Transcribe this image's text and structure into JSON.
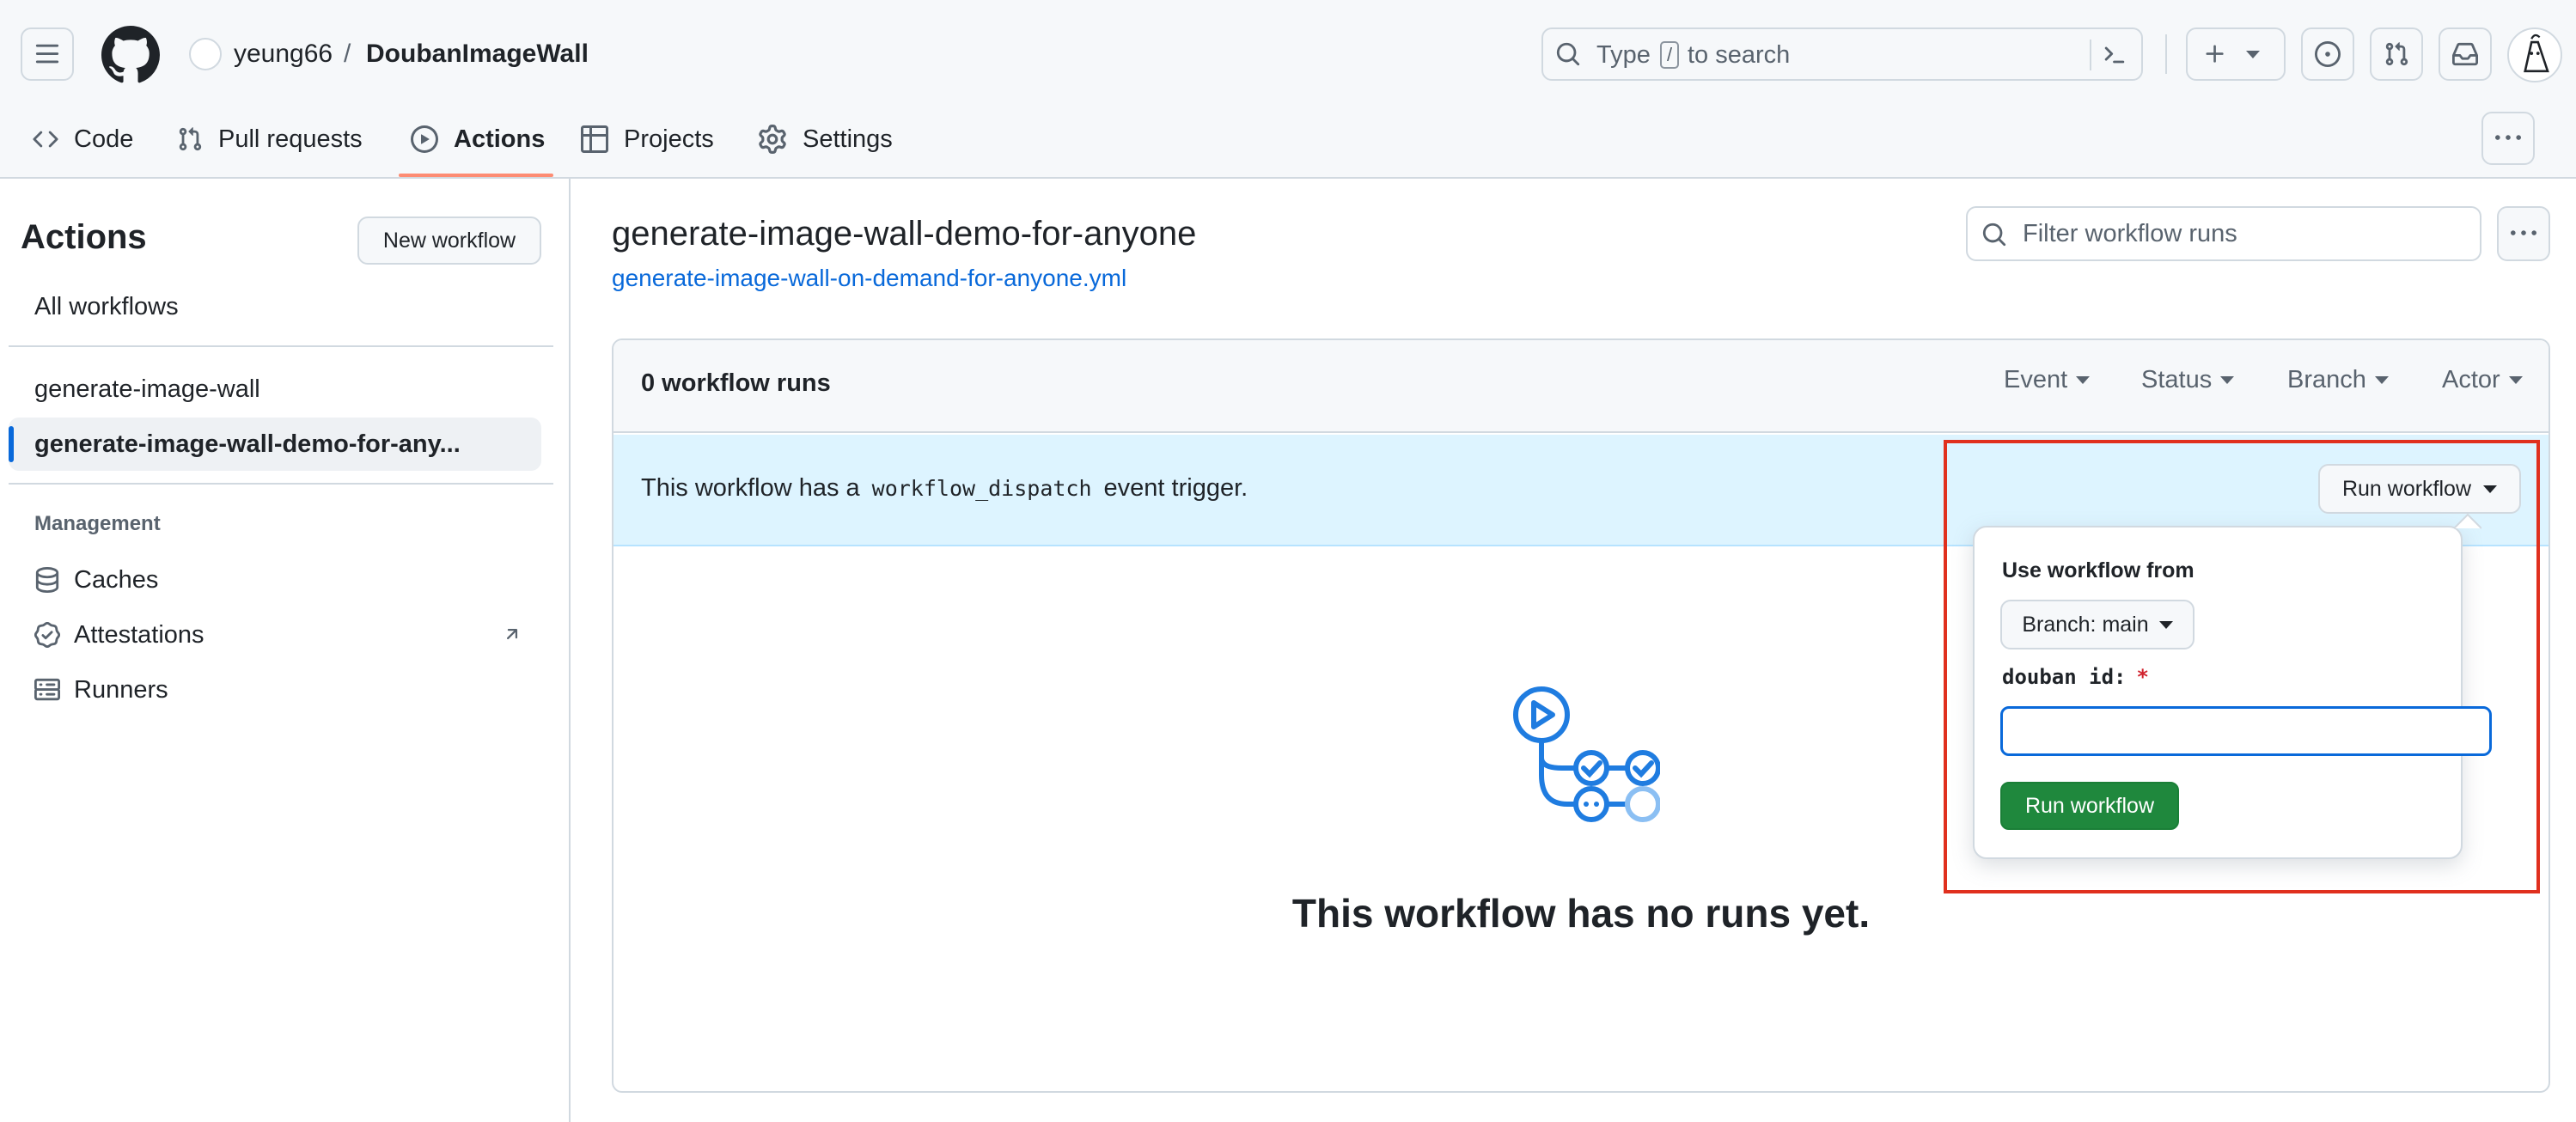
{
  "header": {
    "owner": "yeung66",
    "separator": "/",
    "repo": "DoubanImageWall",
    "search_prefix": "Type",
    "search_key": "/",
    "search_suffix": "to search"
  },
  "tabs": [
    {
      "label": "Code",
      "icon": "code-icon"
    },
    {
      "label": "Pull requests",
      "icon": "git-pull-request-icon"
    },
    {
      "label": "Actions",
      "icon": "play-icon",
      "active": true
    },
    {
      "label": "Projects",
      "icon": "table-icon"
    },
    {
      "label": "Settings",
      "icon": "gear-icon"
    }
  ],
  "sidebar": {
    "title": "Actions",
    "new_workflow": "New workflow",
    "all_workflows": "All workflows",
    "workflows": [
      "generate-image-wall",
      "generate-image-wall-demo-for-any..."
    ],
    "management_label": "Management",
    "management": [
      {
        "label": "Caches",
        "icon": "database-icon"
      },
      {
        "label": "Attestations",
        "icon": "verified-icon"
      },
      {
        "label": "Runners",
        "icon": "server-icon"
      }
    ]
  },
  "main": {
    "workflow_title": "generate-image-wall-demo-for-anyone",
    "workflow_file": "generate-image-wall-on-demand-for-anyone.yml",
    "filter_placeholder": "Filter workflow runs",
    "runs_count": "0 workflow runs",
    "filters": [
      "Event",
      "Status",
      "Branch",
      "Actor"
    ],
    "banner_prefix": "This workflow has a",
    "banner_code": "workflow_dispatch",
    "banner_suffix": "event trigger.",
    "run_workflow_button": "Run workflow",
    "empty_message": "This workflow has no runs yet."
  },
  "popup": {
    "use_from_label": "Use workflow from",
    "branch_button": "Branch: main",
    "input_label": "douban id:",
    "required_mark": "*",
    "input_value": "",
    "submit": "Run workflow"
  },
  "colors": {
    "accent_blue": "#0969da",
    "run_green": "#1f883d",
    "banner_bg": "#ddf4ff",
    "highlight_red": "#e0301e",
    "tab_underline": "#fd8c73"
  }
}
